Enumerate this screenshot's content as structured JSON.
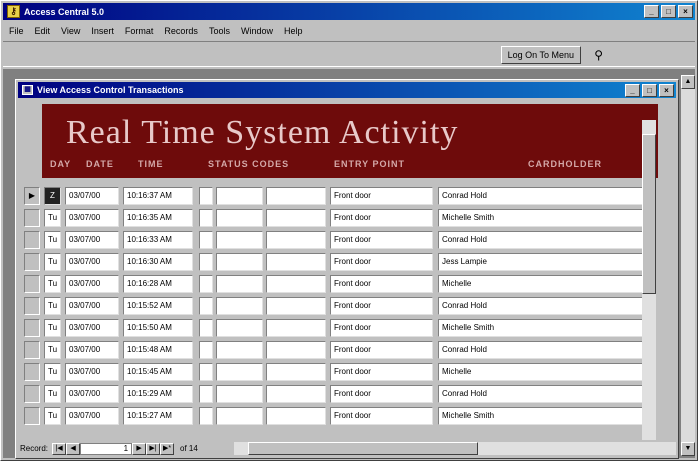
{
  "app": {
    "title": "Access Central 5.0",
    "menu": [
      "File",
      "Edit",
      "View",
      "Insert",
      "Format",
      "Records",
      "Tools",
      "Window",
      "Help"
    ],
    "logon_button": "Log On To Menu",
    "window_buttons": [
      "_",
      "□",
      "×"
    ]
  },
  "child": {
    "title": "View Access Control Transactions",
    "window_buttons": [
      "_",
      "□",
      "×"
    ]
  },
  "form": {
    "banner_title": "Real Time System Activity",
    "columns": {
      "day": "DAY",
      "date": "DATE",
      "time": "TIME",
      "status": "STATUS CODES",
      "entry": "ENTRY POINT",
      "holder": "CARDHOLDER"
    },
    "rows": [
      {
        "day": "Z",
        "date": "03/07/00",
        "time": "10:16:37 AM",
        "entry": "Front door",
        "holder": "Conrad Hold"
      },
      {
        "day": "Tu",
        "date": "03/07/00",
        "time": "10:16:35 AM",
        "entry": "Front door",
        "holder": "Michelle Smith"
      },
      {
        "day": "Tu",
        "date": "03/07/00",
        "time": "10:16:33 AM",
        "entry": "Front door",
        "holder": "Conrad Hold"
      },
      {
        "day": "Tu",
        "date": "03/07/00",
        "time": "10:16:30 AM",
        "entry": "Front door",
        "holder": "Jess Lampie"
      },
      {
        "day": "Tu",
        "date": "03/07/00",
        "time": "10:16:28 AM",
        "entry": "Front door",
        "holder": "Michelle"
      },
      {
        "day": "Tu",
        "date": "03/07/00",
        "time": "10:15:52 AM",
        "entry": "Front door",
        "holder": "Conrad Hold"
      },
      {
        "day": "Tu",
        "date": "03/07/00",
        "time": "10:15:50 AM",
        "entry": "Front door",
        "holder": "Michelle Smith"
      },
      {
        "day": "Tu",
        "date": "03/07/00",
        "time": "10:15:48 AM",
        "entry": "Front door",
        "holder": "Conrad Hold"
      },
      {
        "day": "Tu",
        "date": "03/07/00",
        "time": "10:15:45 AM",
        "entry": "Front door",
        "holder": "Michelle"
      },
      {
        "day": "Tu",
        "date": "03/07/00",
        "time": "10:15:29 AM",
        "entry": "Front door",
        "holder": "Conrad Hold"
      },
      {
        "day": "Tu",
        "date": "03/07/00",
        "time": "10:15:27 AM",
        "entry": "Front door",
        "holder": "Michelle Smith"
      }
    ]
  },
  "nav": {
    "label": "Record:",
    "current": "1",
    "of_text": "of 14",
    "btn_first": "|◀",
    "btn_prev": "◀",
    "btn_next": "▶",
    "btn_last": "▶|",
    "btn_new": "▶*"
  },
  "icons": {
    "app": "key-icon",
    "logon": "binoculars-icon",
    "record_selector": "current-record-arrow-icon"
  }
}
